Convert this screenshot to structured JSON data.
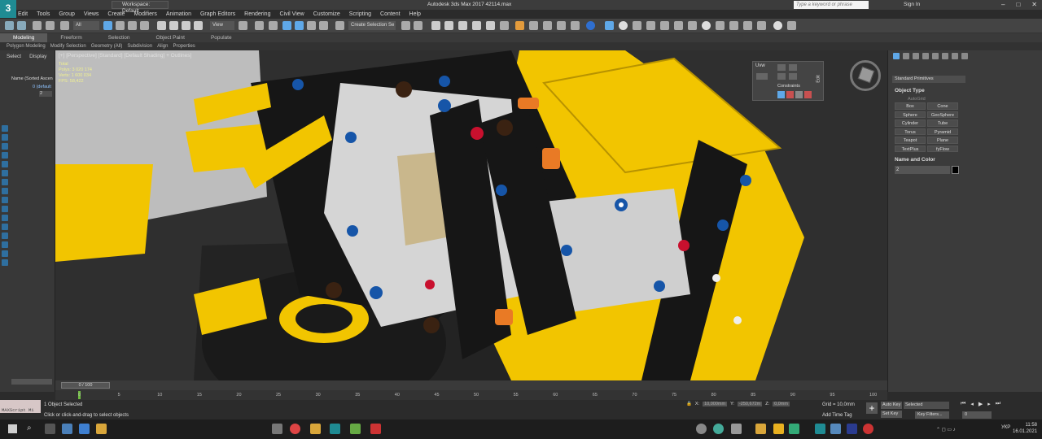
{
  "app": {
    "window_title": "Autodesk 3ds Max 2017    42114.max",
    "workspace": "Workspace: Default",
    "search_placeholder": "Type a keyword or phrase",
    "sign_in": "Sign In",
    "logo_text": "3"
  },
  "menu": [
    "Edit",
    "Tools",
    "Group",
    "Views",
    "Create",
    "Modifiers",
    "Animation",
    "Graph Editors",
    "Rendering",
    "Civil View",
    "Customize",
    "Scripting",
    "Content",
    "Help"
  ],
  "toolbar": {
    "filter_all": "All",
    "view_dropdown": "View",
    "selection_set": "Create Selection Se"
  },
  "ribbon": {
    "tabs": [
      "Modeling",
      "Freeform",
      "Selection",
      "Object Paint",
      "Populate"
    ],
    "active": "Modeling",
    "sub_items": [
      "Polygon Modeling",
      "Modify Selection",
      "Geometry (All)",
      "Subdivision",
      "Align",
      "Properties"
    ]
  },
  "explorer": {
    "tabs": [
      "Select",
      "Display"
    ],
    "header": "Name (Sorted Ascen",
    "item_default": "0 (default",
    "item_2": "2"
  },
  "viewport": {
    "label": "[+] [Perspective] [Standard] [Default Shading] + Outlines]",
    "stats_polys": "Polys:",
    "stats_verts": "Verts:",
    "stats_fps": "FPS:",
    "stats_total": "Total",
    "stats_val1": "3 020 174",
    "stats_val2": "1 600 034",
    "stats_fps_val": "58,422"
  },
  "uvw": {
    "title": "Uvw",
    "constraints": "Constraints",
    "edit": "Edit"
  },
  "command_panel": {
    "dropdown": "Standard Primitives",
    "object_type_title": "Object Type",
    "autogrid": "AutoGrid",
    "primitives": [
      "Box",
      "Cone",
      "Sphere",
      "GeoSphere",
      "Cylinder",
      "Tube",
      "Torus",
      "Pyramid",
      "Teapot",
      "Plane",
      "TextPlus",
      "fyFlow"
    ],
    "name_color_title": "Name and Color",
    "name_value": "2"
  },
  "timeline": {
    "slider": "0 / 100",
    "ticks": [
      "0",
      "5",
      "10",
      "15",
      "20",
      "25",
      "30",
      "35",
      "40",
      "45",
      "50",
      "55",
      "60",
      "65",
      "70",
      "75",
      "80",
      "85",
      "90",
      "95",
      "100"
    ]
  },
  "status": {
    "maxscript": "MAXScript Mi",
    "selected": "1 Object Selected",
    "prompt": "Click or click-and-drag to select objects",
    "x_label": "X:",
    "x_value": "10,000mm",
    "y_label": "Y:",
    "y_value": "-250,672m",
    "z_label": "Z:",
    "z_value": "0,0mm",
    "grid": "Grid = 10,0mm",
    "add_time_tag": "Add Time Tag",
    "auto_key": "Auto Key",
    "set_key": "Set Key",
    "selected_dd": "Selected",
    "key_filters": "Key Filters...",
    "frame": "0"
  },
  "taskbar": {
    "lang": "УКР",
    "time": "11:58",
    "date": "16.01.2021"
  },
  "colors": {
    "lego_yellow": "#f2c500",
    "lego_black": "#161616",
    "lego_grey": "#bdbdbd",
    "lego_blue": "#1655a8",
    "lego_red": "#c8102e",
    "lego_orange": "#e97a25",
    "lego_green": "#3ca34a",
    "lego_brown": "#3a2212",
    "accent_blue": "#2f80d6"
  }
}
